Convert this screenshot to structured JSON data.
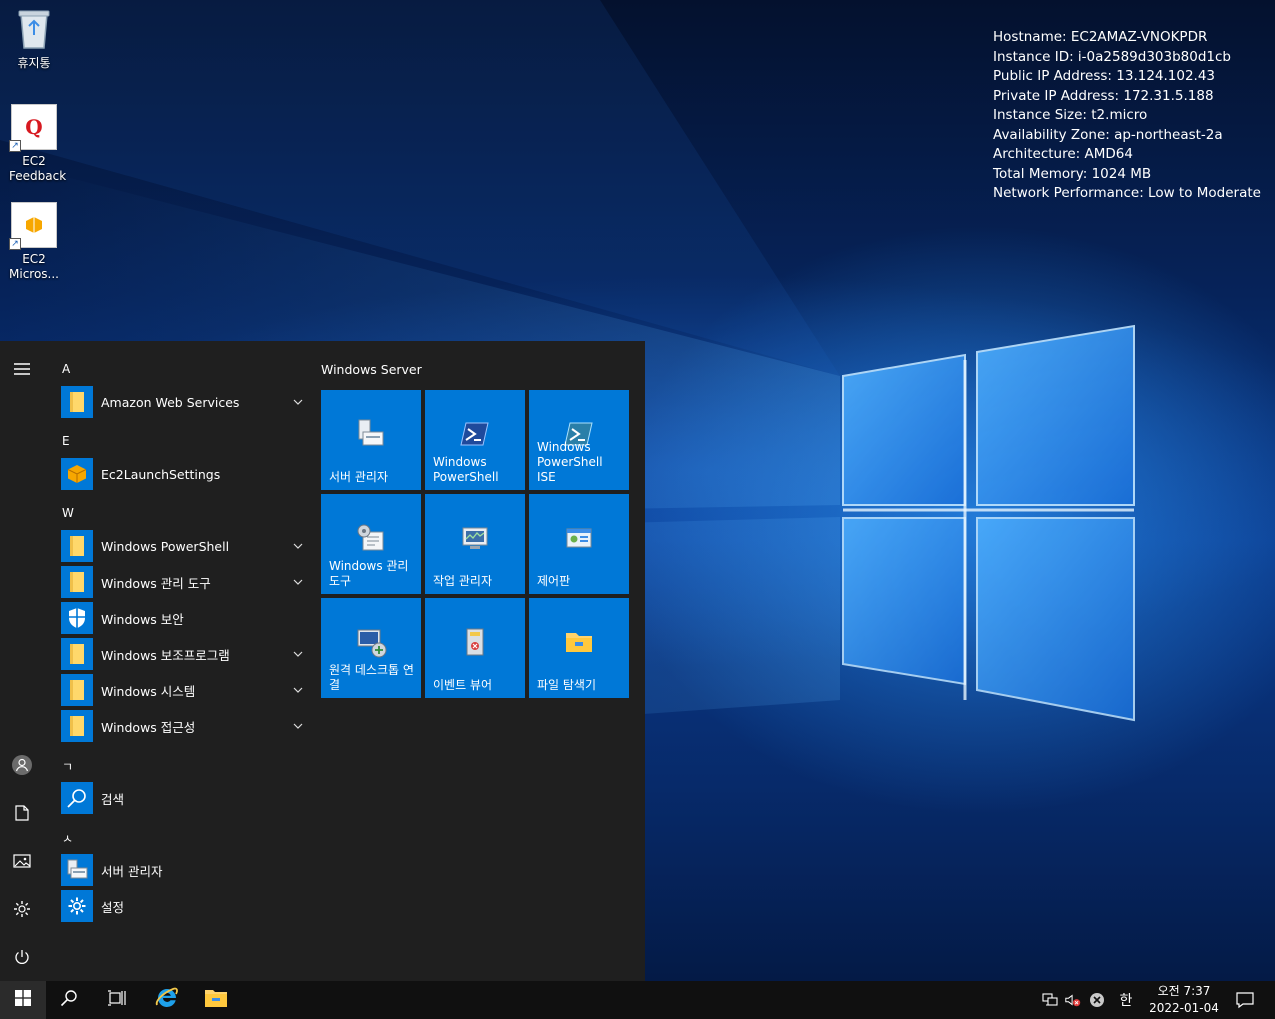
{
  "desktop": {
    "icons": [
      {
        "label": "휴지통",
        "icon": "recycle-bin-icon"
      },
      {
        "label": "EC2 Feedback",
        "icon": "ec2-feedback-icon"
      },
      {
        "label": "EC2 Micros...",
        "icon": "ec2-microsoft-icon"
      }
    ],
    "info_lines": [
      "Hostname: EC2AMAZ-VNOKPDR",
      "Instance ID: i-0a2589d303b80d1cb",
      "Public IP Address: 13.124.102.43",
      "Private IP Address: 172.31.5.188",
      "Instance Size: t2.micro",
      "Availability Zone: ap-northeast-2a",
      "Architecture: AMD64",
      "Total Memory: 1024 MB",
      "Network Performance: Low to Moderate"
    ]
  },
  "start_menu": {
    "rail": [
      "hamburger-icon",
      "user-icon",
      "documents-icon",
      "pictures-icon",
      "settings-icon",
      "power-icon"
    ],
    "sections": [
      {
        "letter": "A",
        "apps": [
          {
            "label": "Amazon Web Services",
            "expandable": true,
            "icon": "folder-icon"
          }
        ]
      },
      {
        "letter": "E",
        "apps": [
          {
            "label": "Ec2LaunchSettings",
            "expandable": false,
            "icon": "package-icon"
          }
        ]
      },
      {
        "letter": "W",
        "apps": [
          {
            "label": "Windows PowerShell",
            "expandable": true,
            "icon": "folder-icon"
          },
          {
            "label": "Windows 관리 도구",
            "expandable": true,
            "icon": "folder-icon"
          },
          {
            "label": "Windows 보안",
            "expandable": false,
            "icon": "shield-icon"
          },
          {
            "label": "Windows 보조프로그램",
            "expandable": true,
            "icon": "folder-icon"
          },
          {
            "label": "Windows 시스템",
            "expandable": true,
            "icon": "folder-icon"
          },
          {
            "label": "Windows 접근성",
            "expandable": true,
            "icon": "folder-icon"
          }
        ]
      },
      {
        "letter": "ㄱ",
        "apps": [
          {
            "label": "검색",
            "expandable": false,
            "icon": "search-icon"
          }
        ]
      },
      {
        "letter": "ㅅ",
        "apps": [
          {
            "label": "서버 관리자",
            "expandable": false,
            "icon": "server-manager-icon"
          },
          {
            "label": "설정",
            "expandable": false,
            "icon": "gear-icon"
          }
        ]
      }
    ],
    "group_title": "Windows Server",
    "tiles": [
      {
        "label": "서버 관리자",
        "icon": "server-manager-icon"
      },
      {
        "label": "Windows PowerShell",
        "icon": "powershell-icon"
      },
      {
        "label": "Windows PowerShell ISE",
        "icon": "powershell-ise-icon"
      },
      {
        "label": "Windows 관리 도구",
        "icon": "admin-tools-icon"
      },
      {
        "label": "작업 관리자",
        "icon": "task-manager-icon"
      },
      {
        "label": "제어판",
        "icon": "control-panel-icon"
      },
      {
        "label": "원격 데스크톱 연결",
        "icon": "remote-desktop-icon"
      },
      {
        "label": "이벤트 뷰어",
        "icon": "event-viewer-icon"
      },
      {
        "label": "파일 탐색기",
        "icon": "file-explorer-icon"
      }
    ]
  },
  "taskbar": {
    "pinned": [
      "start-icon",
      "search-icon",
      "task-view-icon",
      "internet-explorer-icon",
      "file-explorer-icon"
    ],
    "tray": [
      "network-icon",
      "volume-muted-icon",
      "notification-error-icon"
    ],
    "ime": "한",
    "time": "오전 7:37",
    "date": "2022-01-04"
  },
  "colors": {
    "tile": "#0078d7",
    "menu_bg": "#1f1f1f",
    "taskbar_bg": "#101010"
  }
}
